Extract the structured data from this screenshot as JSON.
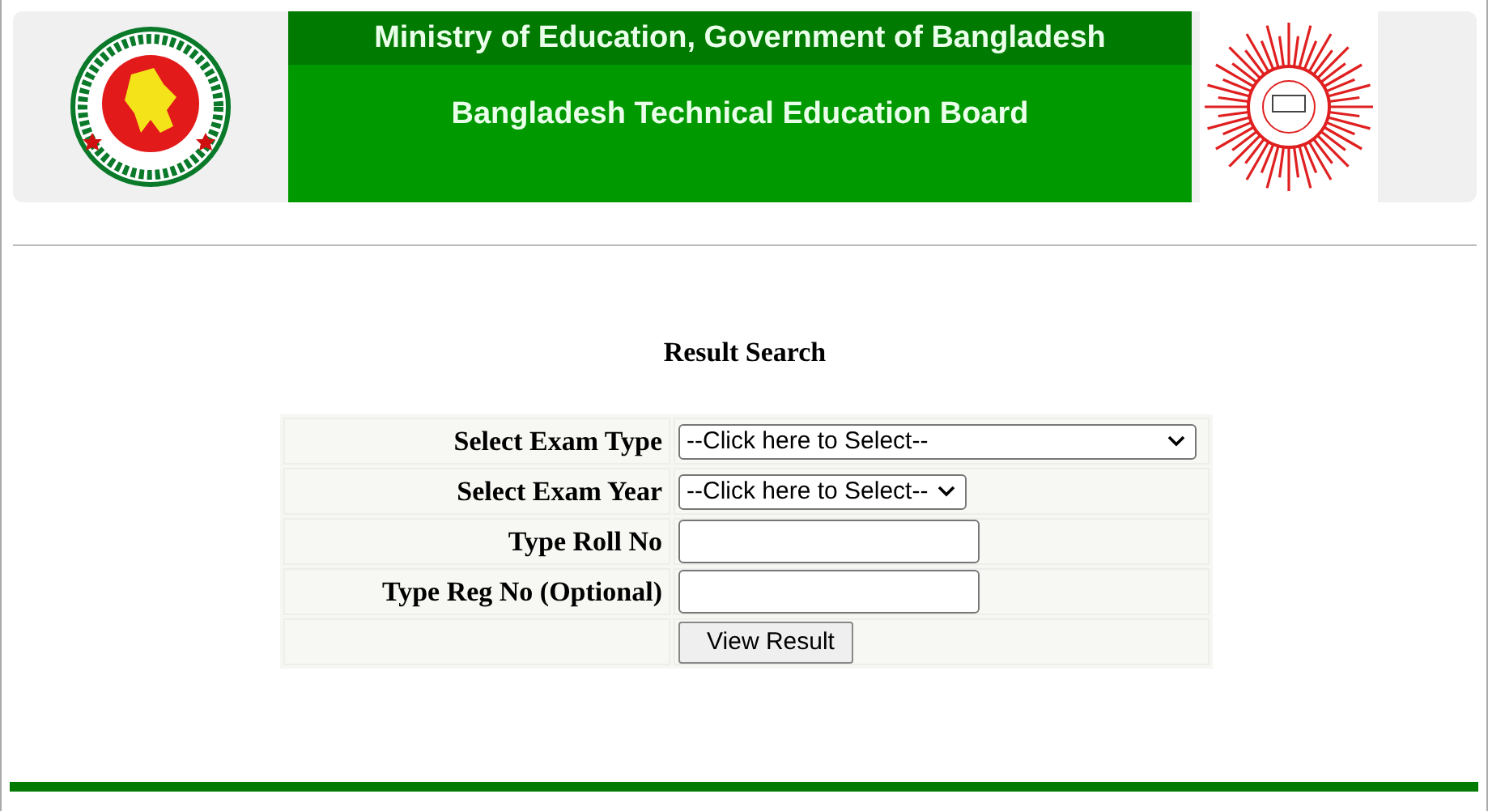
{
  "header": {
    "ministry": "Ministry of Education, Government of Bangladesh",
    "board": "Bangladesh Technical Education Board"
  },
  "title": "Result Search",
  "fields": [
    {
      "kind": "select",
      "label": "Select Exam Type",
      "value": "--Click here to Select--"
    },
    {
      "kind": "select",
      "label": "Select Exam Year",
      "value": "--Click here to Select--"
    },
    {
      "kind": "text",
      "label": "Type Roll No"
    },
    {
      "kind": "text",
      "label": "Type Reg No (Optional)"
    }
  ],
  "submit": "View Result"
}
